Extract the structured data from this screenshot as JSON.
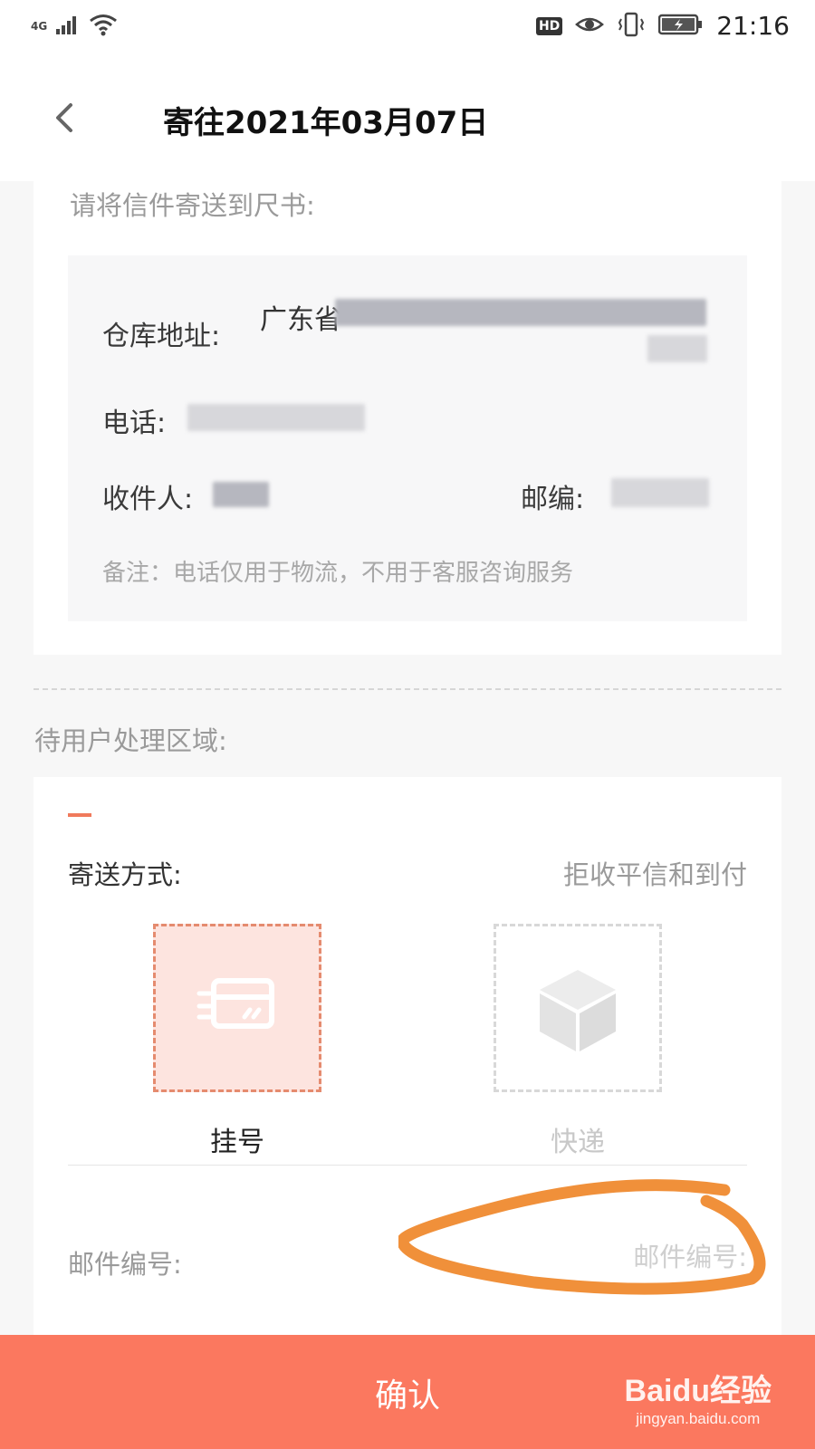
{
  "status_bar": {
    "network": "4G",
    "hd_badge": "HD",
    "time": "21:16",
    "icons": [
      "signal-icon",
      "wifi-icon",
      "eye-icon",
      "vibrate-icon",
      "battery-icon"
    ]
  },
  "header": {
    "title": "寄往2021年03月07日",
    "back_icon": "chevron-left-icon"
  },
  "send_to": {
    "hint": "请将信件寄送到尺书:",
    "warehouse_label": "仓库地址:",
    "warehouse_value_visible": "广东省",
    "phone_label": "电话:",
    "recipient_label": "收件人:",
    "postcode_label": "邮编:",
    "note": "备注：电话仅用于物流，不用于客服咨询服务"
  },
  "pending": {
    "label": "待用户处理区域:"
  },
  "shipping": {
    "label": "寄送方式:",
    "note": "拒收平信和到付",
    "options": [
      {
        "label": "挂号",
        "icon": "card-icon",
        "selected": true
      },
      {
        "label": "快递",
        "icon": "box-icon",
        "selected": false
      }
    ],
    "mail_number_label": "邮件编号:",
    "mail_number_placeholder": "邮件编号:",
    "mail_number_value": ""
  },
  "footer": {
    "confirm_label": "确认",
    "watermark_brand": "Baidu经验",
    "watermark_url": "jingyan.baidu.com"
  },
  "colors": {
    "accent": "#fb785f",
    "selected_fill": "#fde4df",
    "selected_border": "#e58b6f",
    "annotation_stroke": "#f0903a"
  }
}
